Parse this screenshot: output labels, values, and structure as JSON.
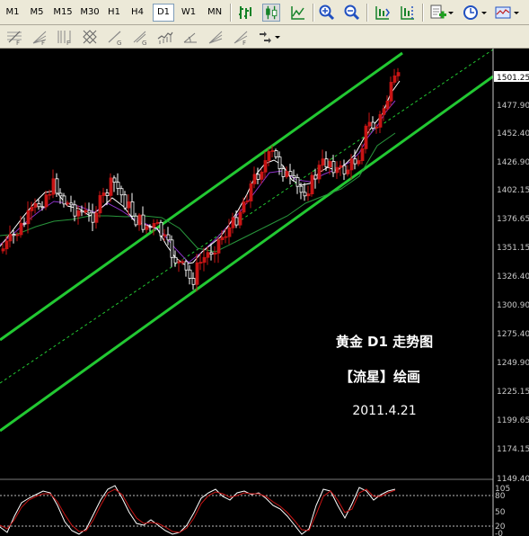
{
  "toolbar": {
    "timeframes": [
      "M1",
      "M5",
      "M15",
      "M30",
      "H1",
      "H4",
      "D1",
      "W1",
      "MN"
    ],
    "selected_timeframe": "D1"
  },
  "chart": {
    "current_price": "1501.25",
    "price_axis": [
      "1477.90",
      "1452.40",
      "1426.90",
      "1402.15",
      "1376.65",
      "1351.15",
      "1326.40",
      "1300.90",
      "1275.40",
      "1249.90",
      "1225.15",
      "1199.65",
      "1174.15",
      "1149.40"
    ],
    "caption_line1": "黄金 D1 走势图",
    "caption_line2": "【流星】绘画",
    "caption_date": "2011.4.21"
  },
  "oscillator": {
    "axis": [
      "105",
      "80",
      "50",
      "20",
      "-0"
    ]
  },
  "colors": {
    "background": "#000000",
    "channel": "#22c832",
    "bull_candle": "#c81414",
    "bear_candle": "#ffffff",
    "ma_fast": "#ffffff",
    "ma_mid": "#8c32c8",
    "ma_slow": "#28963c"
  }
}
